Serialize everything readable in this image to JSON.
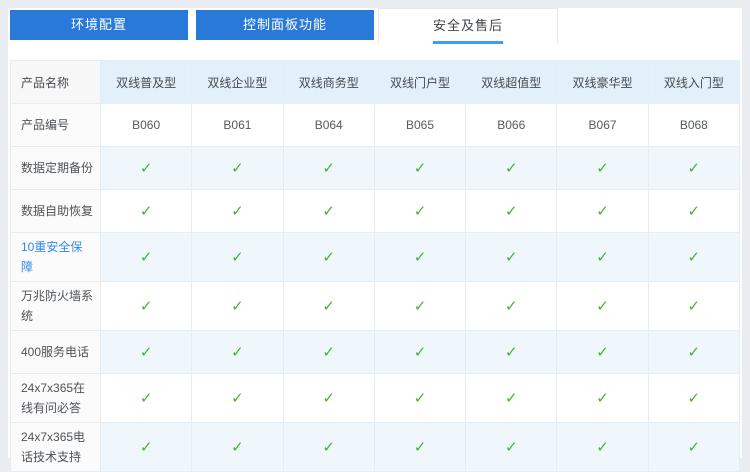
{
  "tabs": [
    {
      "label": "环境配置",
      "active": false
    },
    {
      "label": "控制面板功能",
      "active": false
    },
    {
      "label": "安全及售后",
      "active": true
    }
  ],
  "table": {
    "corner_header": "产品名称",
    "columns": [
      "双线普及型",
      "双线企业型",
      "双线商务型",
      "双线门户型",
      "双线超值型",
      "双线豪华型",
      "双线入门型"
    ],
    "rows": [
      {
        "label": "产品编号",
        "type": "text",
        "values": [
          "B060",
          "B061",
          "B064",
          "B065",
          "B066",
          "B067",
          "B068"
        ]
      },
      {
        "label": "数据定期备份",
        "type": "check"
      },
      {
        "label": "数据自助恢复",
        "type": "check"
      },
      {
        "label": "10重安全保障",
        "type": "check",
        "link": true
      },
      {
        "label": "万兆防火墙系统",
        "type": "check"
      },
      {
        "label": "400服务电话",
        "type": "check"
      },
      {
        "label": "24x7x365在线有问必答",
        "type": "check"
      },
      {
        "label": "24x7x365电话技术支持",
        "type": "check"
      }
    ],
    "check_glyph": "✓"
  },
  "colors": {
    "tab_blue": "#2979d9",
    "active_tab_underline": "#38a1f1",
    "header_cell_blue": "#e2f0f9",
    "alt_row_blue": "#eff7fd",
    "check_green": "#47b42c",
    "link_blue": "#3388e8"
  }
}
